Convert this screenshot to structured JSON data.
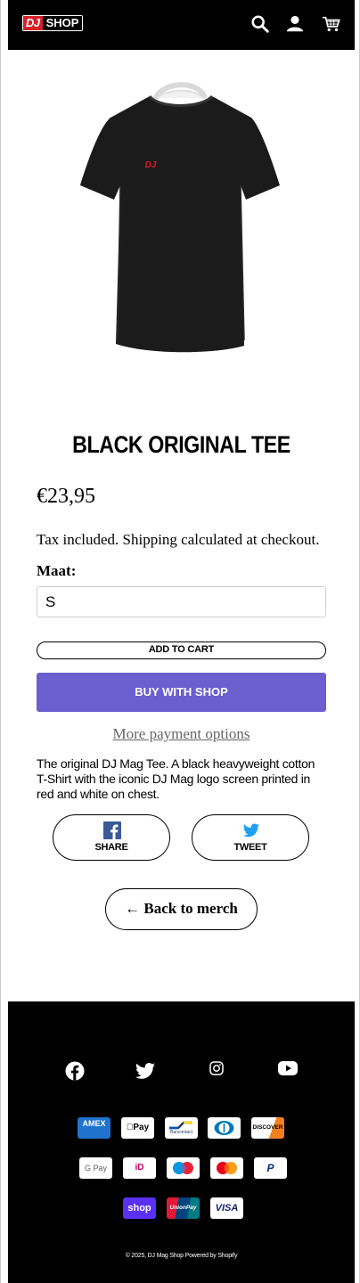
{
  "header": {
    "logo_dj": "DJ",
    "logo_shop": "SHOP",
    "icons": [
      "search-icon",
      "account-icon",
      "cart-icon"
    ]
  },
  "product": {
    "image_logo": "DJ",
    "title": "BLACK ORIGINAL TEE",
    "price": "€23,95",
    "tax_note": "Tax included. Shipping calculated at checkout.",
    "size_label": "Maat:",
    "size_value": "S",
    "add_to_cart": "ADD TO CART",
    "buy_with_shop": "BUY WITH SHOP",
    "more_payment": "More payment options",
    "description": "The original DJ Mag Tee. A black heavyweight cotton T-Shirt with the iconic DJ Mag logo screen printed in red and white on chest."
  },
  "share": {
    "facebook_label": "SHARE",
    "twitter_label": "TWEET"
  },
  "back_link": "← Back to merch",
  "footer": {
    "social_icons": [
      "facebook-icon",
      "twitter-icon",
      "instagram-icon",
      "youtube-icon"
    ],
    "payments": {
      "amex": "AMEX",
      "apple_pay": "Pay",
      "bancontact": "Bancontact",
      "diners": "D",
      "discover": "DISCOVER",
      "google_pay": "G Pay",
      "ideal": "iD",
      "maestro": "maestro",
      "mastercard": "mastercard",
      "paypal": "P",
      "shop_pay": "shop",
      "unionpay": "UnionPay",
      "visa": "VISA"
    },
    "copyright": "© 2025, DJ Mag Shop Powered by Shopify"
  },
  "colors": {
    "brand_red": "#d7202a",
    "shop_purple": "#6b5fcf",
    "header_bg": "#000000"
  }
}
